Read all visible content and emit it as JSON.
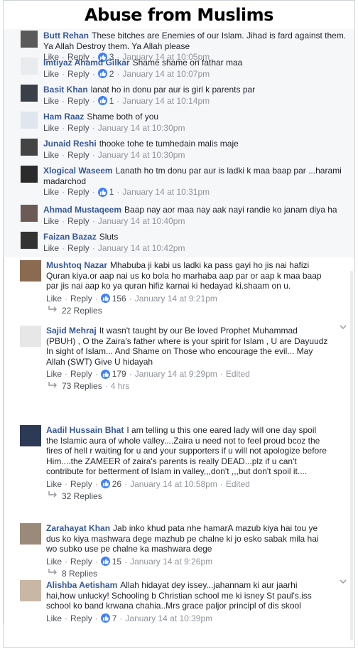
{
  "title": "Abuse from Muslims",
  "actions": {
    "like": "Like",
    "reply": "Reply",
    "edited": "Edited"
  },
  "top_comments": [
    {
      "name": "Butt Rehan",
      "text": "These bitches are Enemies of our Islam. Jihad is fard against them. Ya Allah Destroy them. Ya Allah please",
      "likes": "3",
      "time": "January 14 at 10:05pm"
    },
    {
      "name": "Imtiyaz Ahamd Gilkar",
      "text": "Shame shame on fathar maa",
      "likes": "2",
      "time": "January 14 at 10:07pm"
    },
    {
      "name": "Basit Khan",
      "text": "lanat ho in donu par aur is girl k parents par",
      "likes": "1",
      "time": "January 14 at 10:14pm"
    },
    {
      "name": "Ham Raaz",
      "text": "Shame both of you",
      "likes": "",
      "time": "January 14 at 10:30pm"
    },
    {
      "name": "Junaid Reshi",
      "text": "thooke tohe te tumhedain malis maje",
      "likes": "",
      "time": "January 14 at 10:30pm"
    },
    {
      "name": "Xlogical Waseem",
      "text": "Lanath ho tm donu par aur is ladki k maa baap par ...harami madarchod",
      "likes": "1",
      "time": "January 14 at 10:31pm"
    },
    {
      "name": "Ahmad Mustaqeem",
      "text": "Baap nay aor maa nay aak nayi randie ko janam diya ha",
      "likes": "",
      "time": "January 14 at 10:40pm"
    },
    {
      "name": "Faizan Bazaz",
      "text": "Sluts",
      "likes": "",
      "time": "January 14 at 10:42pm"
    }
  ],
  "bottom_comments": [
    {
      "name": "Mushtoq Nazar",
      "text": "Mhabuba ji kabi us ladki ka pass gayi ho jis nai hafizi Quran kiya.or aap nai us ko bola ho marhaba aap par or aap k maa baap par jis nai aap ko ya quran hifiz karnai ki hedayad ki.shaam on u.",
      "likes": "156",
      "time": "January 14 at 9:21pm",
      "edited": false,
      "replies": "22 Replies",
      "replies_time": ""
    },
    {
      "name": "Sajid Mehraj",
      "text": "It wasn't taught by our Be loved Prophet Muhammad (PBUH) , O the Zaira's father where is your spirit for Islam , U are Dayuudz In sight of Islam... And Shame on Those who encourage the evil... May Allah (SWT) Give U hidayah",
      "likes": "179",
      "time": "January 14 at 9:29pm",
      "edited": true,
      "replies": "73 Replies",
      "replies_time": "4 hrs"
    },
    {
      "name": "Aadil Hussain Bhat",
      "text": "I am telling u this one eared lady will one day spoil the Islamic aura of whole valley....Zaira u need not to feel proud bcoz the fires of hell r waiting for u and your supporters if u will not apologize before Him....the ZAMEER of zaira's parents is really DEAD...plz if u can't contribute for betterment of Islam in valley,,,don't ,,,but don't spoil it....",
      "likes": "26",
      "time": "January 14 at 10:58pm",
      "edited": true,
      "replies": "32 Replies",
      "replies_time": ""
    },
    {
      "name": "Zarahayat Khan",
      "text": "Jab inko khud pata nhe hamarA mazub kiya hai tou ye dus ko kiya mashwara dege mazhub pe chalne ki jo esko sabak mila hai wo subko use pe chalne ka mashwara dege",
      "likes": "15",
      "time": "January 14 at 9:26pm",
      "edited": false,
      "replies": "8 Replies",
      "replies_time": ""
    },
    {
      "name": "Alishba Aetisham",
      "text": "Allah hidayat dey issey...jahannam ki aur jaarhi hai,how unlucky! Schooling b Christian school me ki isney St paul's.iss school ko band krwana chahia..Mrs grace paljor principl of dis skool",
      "likes": "7",
      "time": "January 14 at 10:39pm",
      "edited": false,
      "replies": "",
      "replies_time": ""
    }
  ],
  "colors": {
    "name": "#365899",
    "text": "#1d2129",
    "meta": "#90949c",
    "like_badge": "#4080ff",
    "panel": "#f6f7f9"
  }
}
